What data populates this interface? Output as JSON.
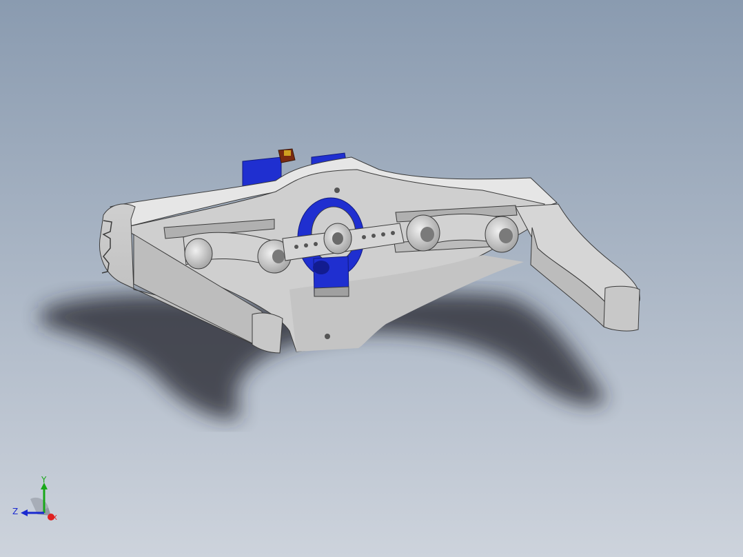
{
  "colors": {
    "bg_top": "#8a9bb0",
    "bg_bottom": "#cdd3dc",
    "part": "#d2d2d2",
    "part_light": "#e4e4e4",
    "part_dark": "#a6a6a6",
    "edge": "#3a3a3a",
    "servo_blue": "#1f2fd0",
    "servo_dark": "#121c90",
    "axis_x": "#e02020",
    "axis_y": "#18a818",
    "axis_z": "#1a2ad0"
  },
  "triad": {
    "x_label": "X",
    "y_label": "Y",
    "z_label": "Z"
  }
}
